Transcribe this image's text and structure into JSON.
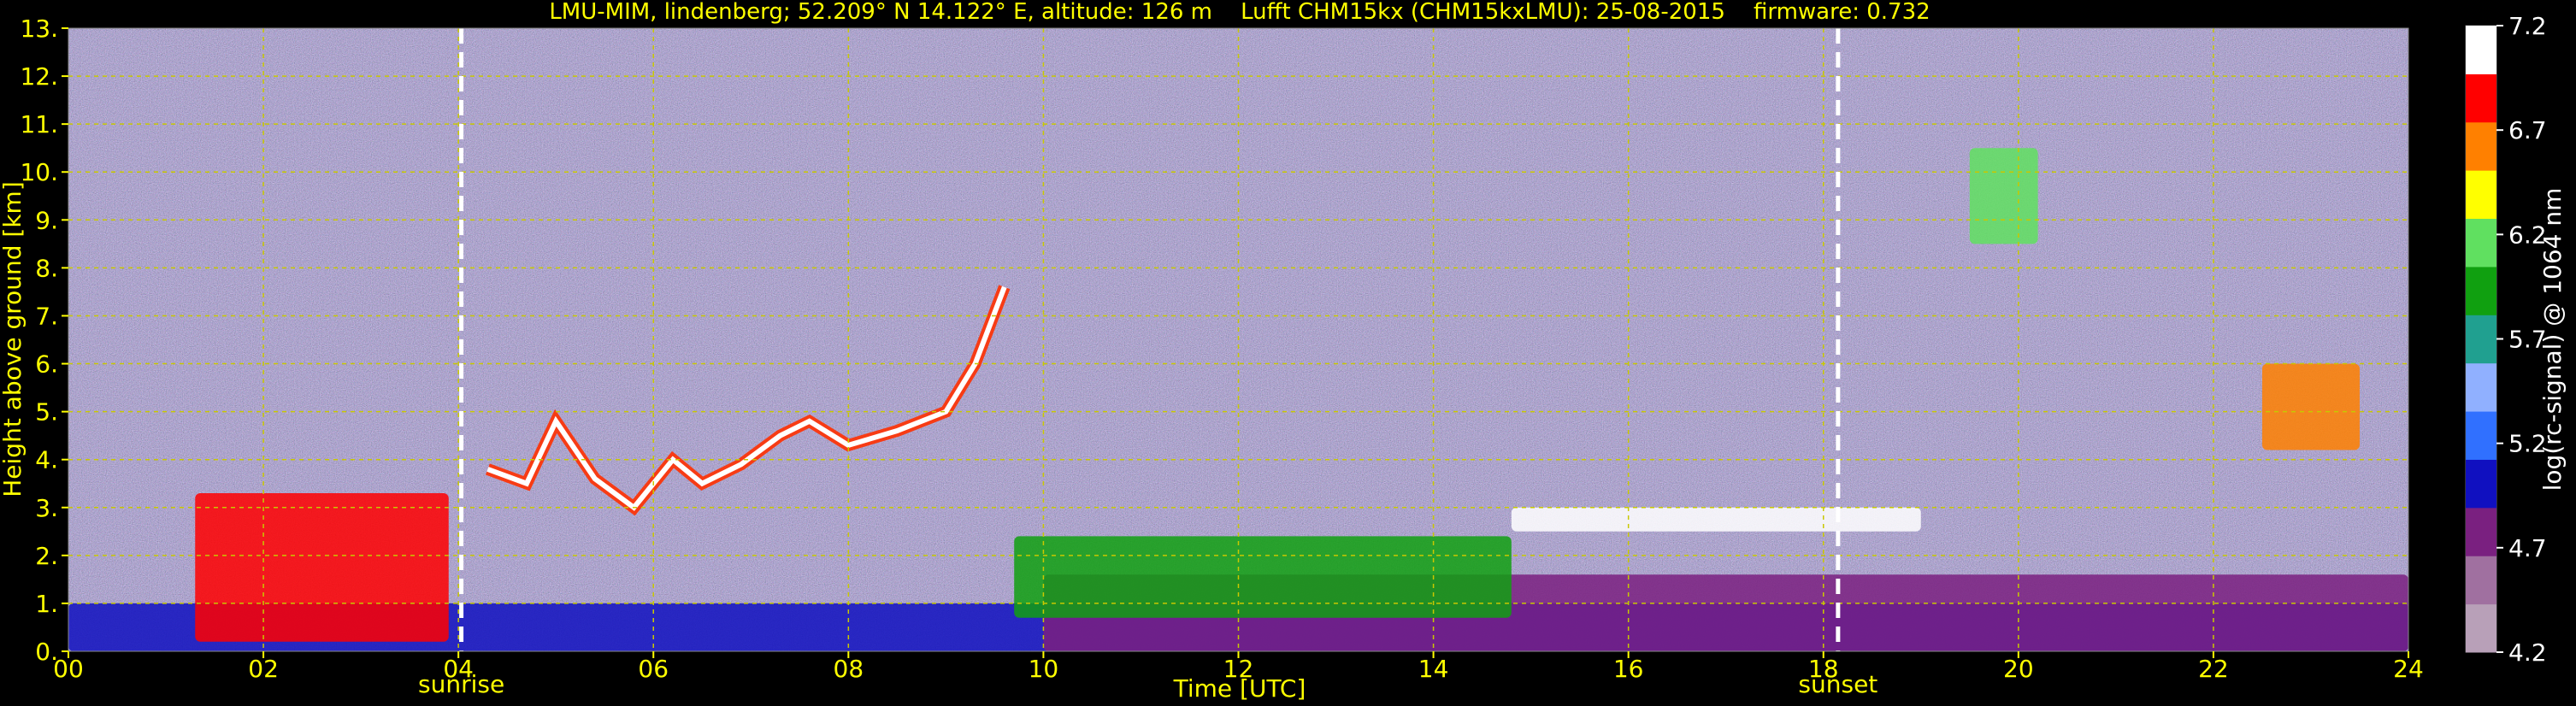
{
  "chart_data": {
    "type": "heatmap",
    "title": "LMU-MIM, lindenberg; 52.209° N 14.122° E, altitude: 126 m    Lufft CHM15kx (CHM15kxLMU): 25-08-2015    firmware: 0.732",
    "xlabel": "Time [UTC]",
    "ylabel": "Height above ground [km]",
    "colorbar_label": "log(rc-signal) @ 1064 nm",
    "xlim": [
      0,
      24
    ],
    "ylim": [
      0,
      13
    ],
    "x_ticks": [
      "00",
      "02",
      "04",
      "06",
      "08",
      "10",
      "12",
      "14",
      "16",
      "18",
      "20",
      "22",
      "24"
    ],
    "y_ticks": [
      "0.",
      "1.",
      "2.",
      "3.",
      "4.",
      "5.",
      "6.",
      "7.",
      "8.",
      "9.",
      "10.",
      "11.",
      "12.",
      "13."
    ],
    "colorbar_range": [
      4.2,
      7.2
    ],
    "colorbar_ticks": [
      "4.2",
      "4.7",
      "5.2",
      "5.7",
      "6.2",
      "6.7",
      "7.2"
    ],
    "grid": true,
    "markers": [
      {
        "time": 4.03,
        "label": "sunrise"
      },
      {
        "time": 18.15,
        "label": "sunset"
      }
    ],
    "layers": [
      {
        "kind": "boundary_layer",
        "start": 0.0,
        "end": 24.0,
        "top_km": 1.0,
        "level": 5.0
      },
      {
        "kind": "residual_layer",
        "start": 10.0,
        "end": 24.0,
        "top_km": 1.6,
        "level": 4.6
      },
      {
        "kind": "aerosol_cloud",
        "start": 1.3,
        "end": 3.9,
        "bottom_km": 0.2,
        "top_km": 3.3,
        "level": 6.9
      },
      {
        "kind": "aerosol_layer",
        "start": 9.7,
        "end": 14.8,
        "bottom_km": 0.7,
        "top_km": 2.4,
        "level": 6.0
      },
      {
        "kind": "cloud_layer",
        "start": 14.8,
        "end": 19.0,
        "bottom_km": 2.5,
        "top_km": 3.0,
        "level": 7.2
      },
      {
        "kind": "cirrus",
        "start": 22.5,
        "end": 23.5,
        "bottom_km": 4.2,
        "top_km": 6.0,
        "level": 6.8
      },
      {
        "kind": "cirrus",
        "start": 19.5,
        "end": 20.2,
        "bottom_km": 8.5,
        "top_km": 10.5,
        "level": 6.3
      }
    ],
    "cloud_base_trace": [
      [
        4.3,
        3.8
      ],
      [
        4.7,
        3.5
      ],
      [
        5.0,
        4.8
      ],
      [
        5.4,
        3.6
      ],
      [
        5.8,
        3.0
      ],
      [
        6.2,
        4.0
      ],
      [
        6.5,
        3.5
      ],
      [
        6.9,
        3.9
      ],
      [
        7.3,
        4.5
      ],
      [
        7.6,
        4.8
      ],
      [
        8.0,
        4.3
      ],
      [
        8.5,
        4.6
      ],
      [
        9.0,
        5.0
      ],
      [
        9.3,
        6.0
      ],
      [
        9.6,
        7.6
      ]
    ]
  },
  "colors": {
    "background": "#000000",
    "text": "#ffff00",
    "grid": "#c8c800",
    "markers": "#ffffff",
    "colormap": [
      "#b8a0b8",
      "#a070a0",
      "#7a2080",
      "#1010c0",
      "#3070ff",
      "#90b0ff",
      "#20a090",
      "#10a010",
      "#60e060",
      "#ffff00",
      "#ff8000",
      "#ff0000",
      "#ffffff"
    ]
  }
}
